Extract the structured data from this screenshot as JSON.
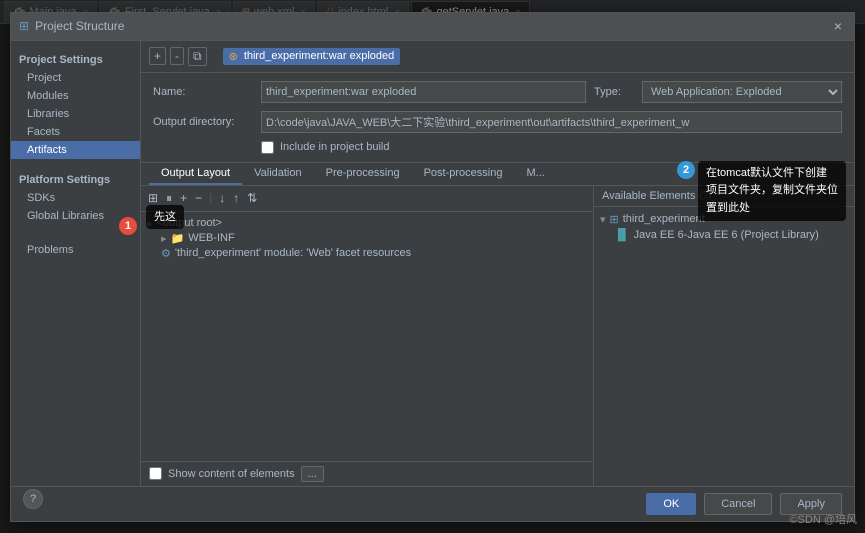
{
  "tabBar": {
    "tabs": [
      {
        "label": "Main.java",
        "icon": "java",
        "active": false
      },
      {
        "label": "First_Servlet.java",
        "icon": "java",
        "active": false
      },
      {
        "label": "web.xml",
        "icon": "xml",
        "active": false
      },
      {
        "label": "index.html",
        "icon": "html",
        "active": false
      },
      {
        "label": "getServlet.java",
        "icon": "java",
        "active": true
      }
    ]
  },
  "dialog": {
    "title": "Project Structure",
    "sidebar": {
      "projectSettings": {
        "label": "Project Settings",
        "items": [
          "Project",
          "Modules",
          "Libraries",
          "Facets",
          "Artifacts"
        ]
      },
      "platformSettings": {
        "label": "Platform Settings",
        "items": [
          "SDKs",
          "Global Libraries"
        ]
      },
      "other": {
        "items": [
          "Problems"
        ]
      }
    },
    "toolbar": {
      "artifactName": "third_experiment:war exploded",
      "addBtn": "+",
      "removeBtn": "-",
      "copyBtn": "⧉"
    },
    "config": {
      "nameLabel": "Name:",
      "nameValue": "third_experiment:war exploded",
      "typeLabel": "Type:",
      "typeValue": "Web Application: Exploded",
      "outputDirLabel": "Output directory:",
      "outputDirValue": "D:\\code\\java\\JAVA_WEB\\大二下实验\\third_experiment\\out\\artifacts\\third_experiment_w",
      "includeLabel": "Include in project build",
      "includeChecked": false
    },
    "tabs": [
      "Output Layout",
      "Validation",
      "Pre-processing",
      "Post-processing",
      "M..."
    ],
    "leftPane": {
      "toolbarBtns": [
        "⊞",
        "⏸",
        "+",
        "-",
        "↓",
        "↑",
        "↓↑"
      ],
      "tree": [
        {
          "label": "<output root>",
          "icon": "root",
          "indent": 0
        },
        {
          "label": "WEB-INF",
          "icon": "folder",
          "indent": 1,
          "expanded": false
        },
        {
          "label": "'third_experiment' module: 'Web' facet resources",
          "icon": "resource",
          "indent": 1
        }
      ]
    },
    "rightPane": {
      "header": "Available Elements",
      "hasHelp": true,
      "tree": [
        {
          "label": "third_experiment",
          "icon": "module",
          "indent": 0,
          "expanded": true
        },
        {
          "label": "Java EE 6-Java EE 6 (Project Library)",
          "icon": "library",
          "indent": 1
        }
      ]
    },
    "showContent": {
      "label": "Show content of elements",
      "checked": false,
      "btnLabel": "..."
    },
    "footer": {
      "okLabel": "OK",
      "cancelLabel": "Cancel",
      "applyLabel": "Apply"
    }
  },
  "annotations": {
    "badge1": "1",
    "badge2": "2",
    "note1": "先这",
    "note2": "在tomcat默认文件下创建\n项目文件夹，复制文件夹位\n置到此处"
  },
  "watermark": "©SDN @培风"
}
